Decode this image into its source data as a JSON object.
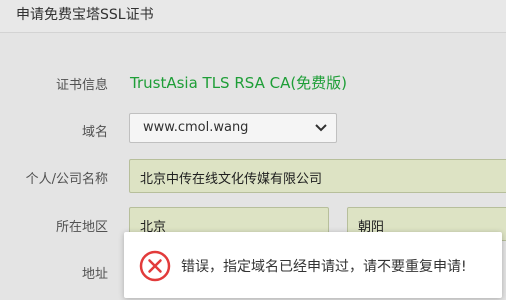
{
  "dialog": {
    "title": "申请免费宝塔SSL证书"
  },
  "form": {
    "cert_info": {
      "label": "证书信息",
      "value": "TrustAsia TLS RSA CA(免费版)"
    },
    "domain": {
      "label": "域名",
      "selected": "www.cmol.wang"
    },
    "company": {
      "label": "个人/公司名称",
      "value": "北京中传在线文化传媒有限公司"
    },
    "region": {
      "label": "所在地区",
      "province": "北京",
      "city": "朝阳"
    },
    "address": {
      "label": "地址"
    }
  },
  "toast": {
    "message": "错误，指定域名已经申请过，请不要重复申请!",
    "icon": "error-circle-icon",
    "color": "#e23b3b"
  },
  "colors": {
    "accent_green": "#20a53a"
  }
}
